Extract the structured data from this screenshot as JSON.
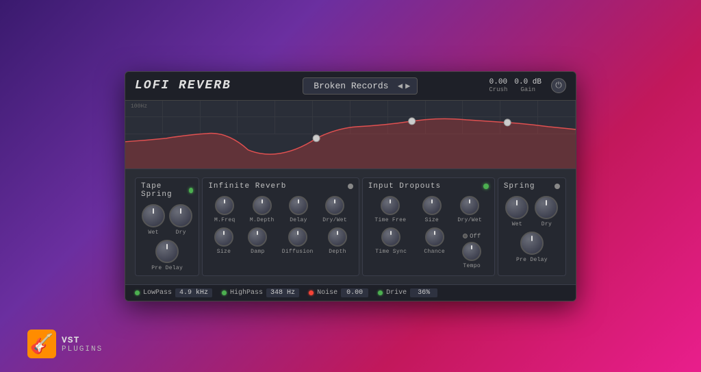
{
  "header": {
    "logo": "LoFi Reverb",
    "preset_name": "Broken Records",
    "crush_value": "0.00",
    "crush_label": "Crush",
    "gain_value": "0.0 dB",
    "gain_label": "Gain",
    "power_icon": "⏻"
  },
  "eq": {
    "label": "100Hz"
  },
  "sections": {
    "tape_spring": {
      "title": "Tape Spring",
      "led": "green",
      "knobs_row1": [
        {
          "label": "Wet"
        },
        {
          "label": "Dry"
        }
      ],
      "knobs_row2": [
        {
          "label": "Pre Delay"
        }
      ]
    },
    "infinite_reverb": {
      "title": "Infinite Reverb",
      "led": "gray",
      "knobs_row1": [
        {
          "label": "M.Freq"
        },
        {
          "label": "M.Depth"
        },
        {
          "label": "Delay"
        },
        {
          "label": "Dry/Wet"
        }
      ],
      "knobs_row2": [
        {
          "label": "Size"
        },
        {
          "label": "Damp"
        },
        {
          "label": "Diffusion"
        },
        {
          "label": "Depth"
        }
      ]
    },
    "input_dropouts": {
      "title": "Input Dropouts",
      "led": "green",
      "knobs_row1": [
        {
          "label": "Time Free"
        },
        {
          "label": "Size"
        },
        {
          "label": "Dry/Wet"
        }
      ],
      "led_off_label": "Off",
      "knobs_row2": [
        {
          "label": "Time Sync"
        },
        {
          "label": "Chance"
        },
        {
          "label": "Tempo"
        }
      ]
    },
    "spring": {
      "title": "Spring",
      "led": "gray",
      "knobs_row1": [
        {
          "label": "Wet"
        },
        {
          "label": "Dry"
        }
      ],
      "knobs_row2": [
        {
          "label": "Pre Delay"
        }
      ]
    }
  },
  "bottom_bar": {
    "params": [
      {
        "led": "green",
        "label": "LowPass",
        "value": "4.9 kHz"
      },
      {
        "led": "green",
        "label": "HighPass",
        "value": "348 Hz"
      },
      {
        "led": "red",
        "label": "Noise",
        "value": "0.00"
      },
      {
        "led": "green",
        "label": "Drive",
        "value": "36%"
      }
    ]
  },
  "branding": {
    "guitar_emoji": "🎸",
    "vst_label": "VST",
    "plugins_label": "PLUGINS"
  },
  "nav": {
    "prev": "◀",
    "next": "▶"
  }
}
